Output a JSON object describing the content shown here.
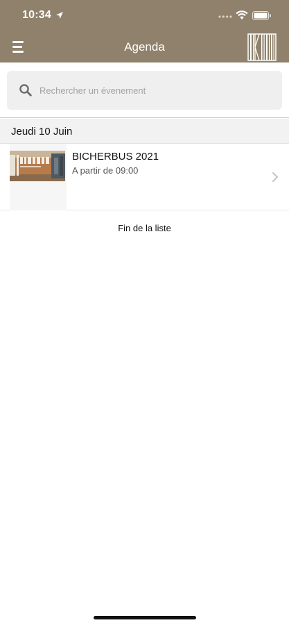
{
  "status_bar": {
    "time": "10:34",
    "location_icon": "location-arrow-icon",
    "signal_icon": "signal-dots-icon",
    "wifi_icon": "wifi-icon",
    "battery_icon": "battery-icon"
  },
  "navbar": {
    "title": "Agenda",
    "menu_icon": "hamburger-menu-icon",
    "logo_icon": "barcode-logo-icon",
    "background_color": "#8f816b"
  },
  "search": {
    "placeholder": "Rechercher un évenement",
    "value": "",
    "icon": "search-icon"
  },
  "agenda": {
    "sections": [
      {
        "date_label": "Jeudi 10 Juin",
        "events": [
          {
            "title": "BICHERBUS 2021",
            "time": "A partir de 09:00",
            "thumbnail_icon": "event-thumbnail-image",
            "chevron_icon": "chevron-right-icon"
          }
        ]
      }
    ],
    "end_of_list": "Fin de la liste"
  }
}
